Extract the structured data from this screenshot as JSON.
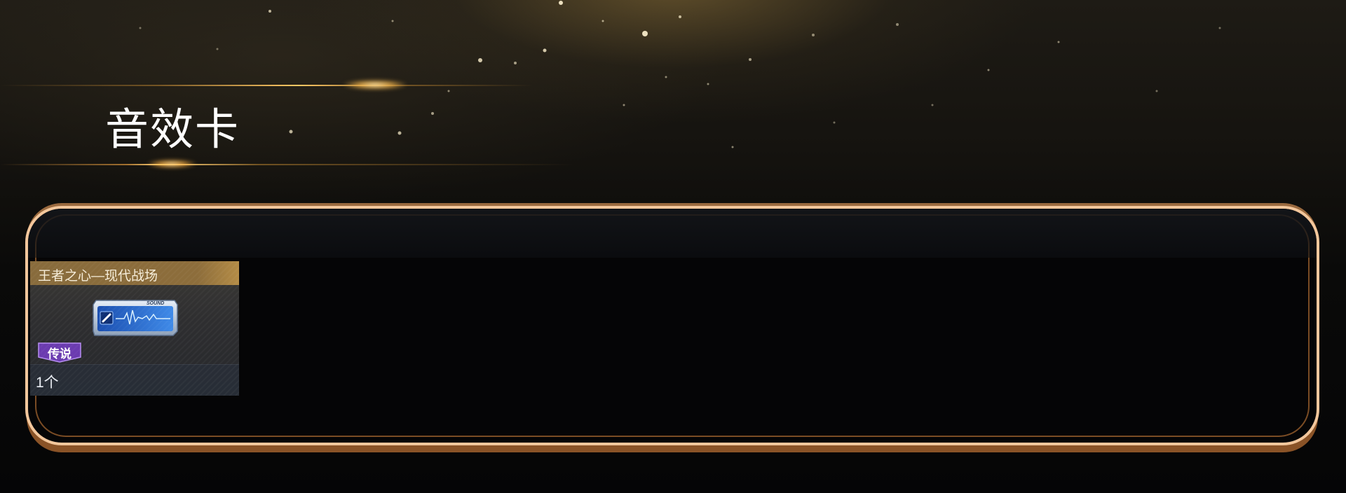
{
  "section": {
    "title": "音效卡"
  },
  "items": [
    {
      "name": "王者之心—现代战场",
      "rarity": "传说",
      "count": "1个",
      "icon": "sound-card-icon",
      "icon_label": "SOUND"
    }
  ],
  "colors": {
    "panel_border": "#f3c79c",
    "panel_border_dark": "#8a5327",
    "name_bar": "#8c6e3c",
    "rarity_badge": "#6b3bb0",
    "glow": "#ffc864"
  }
}
